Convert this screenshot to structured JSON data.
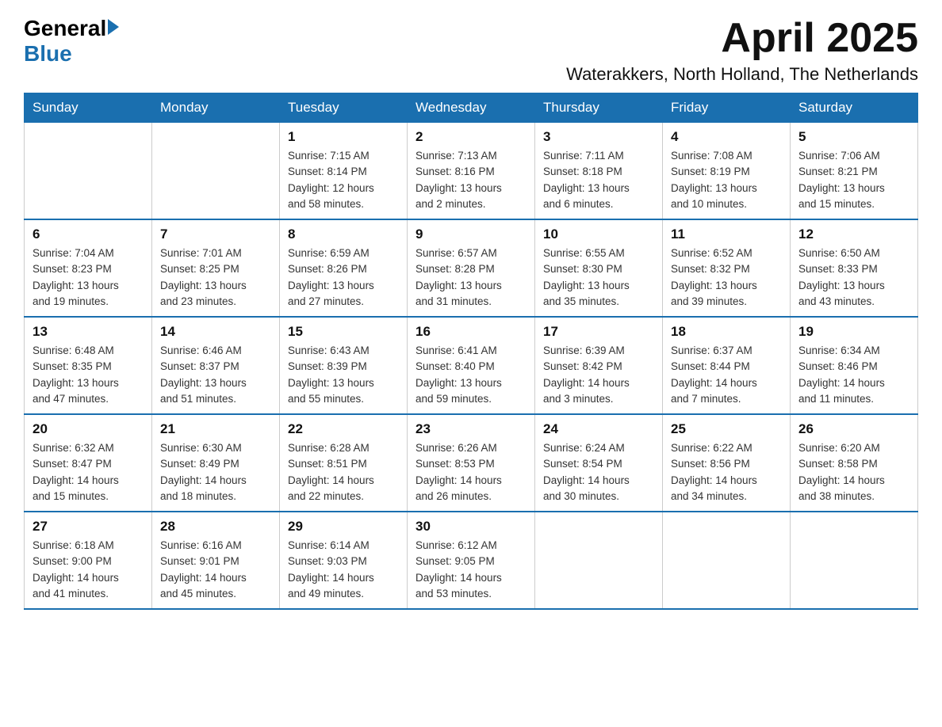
{
  "header": {
    "logo_general": "General",
    "logo_blue": "Blue",
    "title": "April 2025",
    "subtitle": "Waterakkers, North Holland, The Netherlands"
  },
  "weekdays": [
    "Sunday",
    "Monday",
    "Tuesday",
    "Wednesday",
    "Thursday",
    "Friday",
    "Saturday"
  ],
  "weeks": [
    [
      {
        "day": "",
        "info": ""
      },
      {
        "day": "",
        "info": ""
      },
      {
        "day": "1",
        "info": "Sunrise: 7:15 AM\nSunset: 8:14 PM\nDaylight: 12 hours\nand 58 minutes."
      },
      {
        "day": "2",
        "info": "Sunrise: 7:13 AM\nSunset: 8:16 PM\nDaylight: 13 hours\nand 2 minutes."
      },
      {
        "day": "3",
        "info": "Sunrise: 7:11 AM\nSunset: 8:18 PM\nDaylight: 13 hours\nand 6 minutes."
      },
      {
        "day": "4",
        "info": "Sunrise: 7:08 AM\nSunset: 8:19 PM\nDaylight: 13 hours\nand 10 minutes."
      },
      {
        "day": "5",
        "info": "Sunrise: 7:06 AM\nSunset: 8:21 PM\nDaylight: 13 hours\nand 15 minutes."
      }
    ],
    [
      {
        "day": "6",
        "info": "Sunrise: 7:04 AM\nSunset: 8:23 PM\nDaylight: 13 hours\nand 19 minutes."
      },
      {
        "day": "7",
        "info": "Sunrise: 7:01 AM\nSunset: 8:25 PM\nDaylight: 13 hours\nand 23 minutes."
      },
      {
        "day": "8",
        "info": "Sunrise: 6:59 AM\nSunset: 8:26 PM\nDaylight: 13 hours\nand 27 minutes."
      },
      {
        "day": "9",
        "info": "Sunrise: 6:57 AM\nSunset: 8:28 PM\nDaylight: 13 hours\nand 31 minutes."
      },
      {
        "day": "10",
        "info": "Sunrise: 6:55 AM\nSunset: 8:30 PM\nDaylight: 13 hours\nand 35 minutes."
      },
      {
        "day": "11",
        "info": "Sunrise: 6:52 AM\nSunset: 8:32 PM\nDaylight: 13 hours\nand 39 minutes."
      },
      {
        "day": "12",
        "info": "Sunrise: 6:50 AM\nSunset: 8:33 PM\nDaylight: 13 hours\nand 43 minutes."
      }
    ],
    [
      {
        "day": "13",
        "info": "Sunrise: 6:48 AM\nSunset: 8:35 PM\nDaylight: 13 hours\nand 47 minutes."
      },
      {
        "day": "14",
        "info": "Sunrise: 6:46 AM\nSunset: 8:37 PM\nDaylight: 13 hours\nand 51 minutes."
      },
      {
        "day": "15",
        "info": "Sunrise: 6:43 AM\nSunset: 8:39 PM\nDaylight: 13 hours\nand 55 minutes."
      },
      {
        "day": "16",
        "info": "Sunrise: 6:41 AM\nSunset: 8:40 PM\nDaylight: 13 hours\nand 59 minutes."
      },
      {
        "day": "17",
        "info": "Sunrise: 6:39 AM\nSunset: 8:42 PM\nDaylight: 14 hours\nand 3 minutes."
      },
      {
        "day": "18",
        "info": "Sunrise: 6:37 AM\nSunset: 8:44 PM\nDaylight: 14 hours\nand 7 minutes."
      },
      {
        "day": "19",
        "info": "Sunrise: 6:34 AM\nSunset: 8:46 PM\nDaylight: 14 hours\nand 11 minutes."
      }
    ],
    [
      {
        "day": "20",
        "info": "Sunrise: 6:32 AM\nSunset: 8:47 PM\nDaylight: 14 hours\nand 15 minutes."
      },
      {
        "day": "21",
        "info": "Sunrise: 6:30 AM\nSunset: 8:49 PM\nDaylight: 14 hours\nand 18 minutes."
      },
      {
        "day": "22",
        "info": "Sunrise: 6:28 AM\nSunset: 8:51 PM\nDaylight: 14 hours\nand 22 minutes."
      },
      {
        "day": "23",
        "info": "Sunrise: 6:26 AM\nSunset: 8:53 PM\nDaylight: 14 hours\nand 26 minutes."
      },
      {
        "day": "24",
        "info": "Sunrise: 6:24 AM\nSunset: 8:54 PM\nDaylight: 14 hours\nand 30 minutes."
      },
      {
        "day": "25",
        "info": "Sunrise: 6:22 AM\nSunset: 8:56 PM\nDaylight: 14 hours\nand 34 minutes."
      },
      {
        "day": "26",
        "info": "Sunrise: 6:20 AM\nSunset: 8:58 PM\nDaylight: 14 hours\nand 38 minutes."
      }
    ],
    [
      {
        "day": "27",
        "info": "Sunrise: 6:18 AM\nSunset: 9:00 PM\nDaylight: 14 hours\nand 41 minutes."
      },
      {
        "day": "28",
        "info": "Sunrise: 6:16 AM\nSunset: 9:01 PM\nDaylight: 14 hours\nand 45 minutes."
      },
      {
        "day": "29",
        "info": "Sunrise: 6:14 AM\nSunset: 9:03 PM\nDaylight: 14 hours\nand 49 minutes."
      },
      {
        "day": "30",
        "info": "Sunrise: 6:12 AM\nSunset: 9:05 PM\nDaylight: 14 hours\nand 53 minutes."
      },
      {
        "day": "",
        "info": ""
      },
      {
        "day": "",
        "info": ""
      },
      {
        "day": "",
        "info": ""
      }
    ]
  ]
}
